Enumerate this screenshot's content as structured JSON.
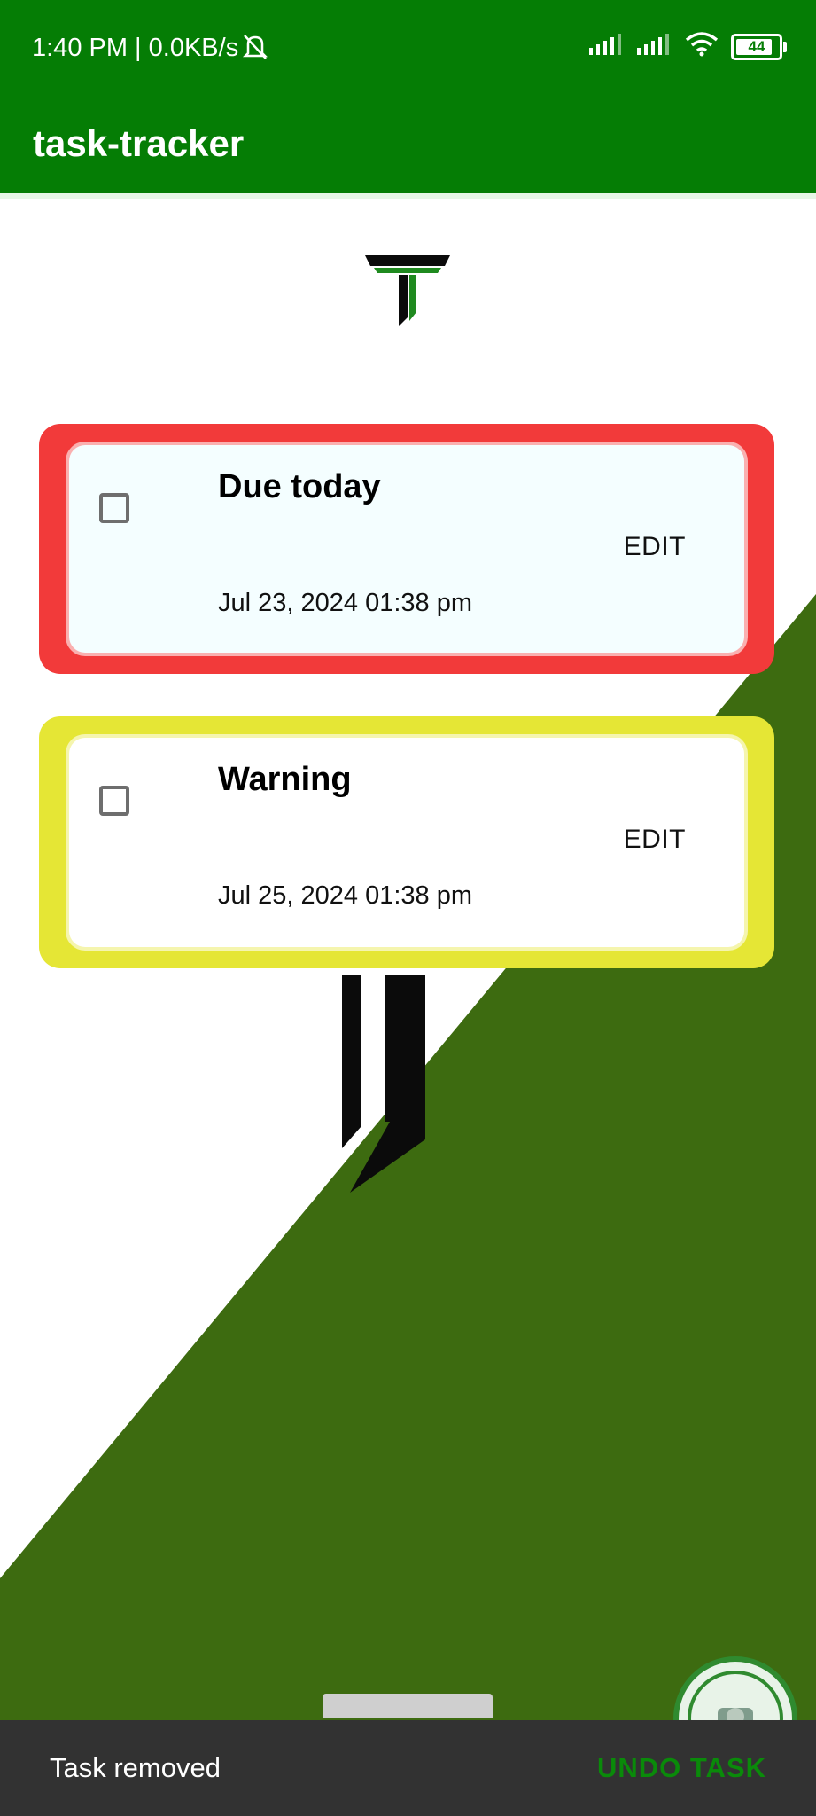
{
  "status_bar": {
    "time": "1:40 PM | 0.0KB/s",
    "battery": "44"
  },
  "app_bar": {
    "title": "task-tracker"
  },
  "tasks": [
    {
      "title": "Due today",
      "date": "Jul 23, 2024 01:38 pm",
      "edit_label": "EDIT",
      "status_color": "#f23a3a"
    },
    {
      "title": "Warning",
      "date": "Jul 25, 2024 01:38 pm",
      "edit_label": "EDIT",
      "status_color": "#e5e635"
    }
  ],
  "snackbar": {
    "message": "Task removed",
    "action": "UNDO TASK"
  },
  "colors": {
    "primary": "#057d05",
    "background_green": "#3d6b10",
    "due_today": "#f23a3a",
    "warning": "#e5e635"
  }
}
